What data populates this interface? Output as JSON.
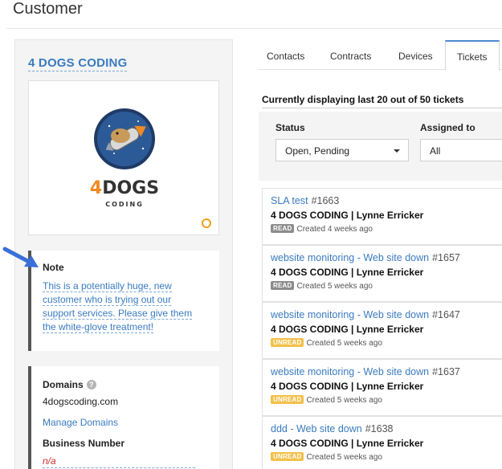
{
  "page": {
    "title": "Customer"
  },
  "customer": {
    "name": "4 DOGS CODING",
    "logo_text": "4DOGS",
    "logo_subtext": "CODING",
    "note": {
      "title": "Note",
      "text": "This is a potentially huge, new customer who is trying out our support services. Please give them the white-glove treatment!"
    },
    "domains_label": "Domains",
    "domain_value": "4dogscoding.com",
    "manage_domains_label": "Manage Domains",
    "business_number_label": "Business Number",
    "business_number_value": "n/a",
    "help_icon": "?"
  },
  "tabs": [
    {
      "label": "Contacts"
    },
    {
      "label": "Contracts"
    },
    {
      "label": "Devices"
    },
    {
      "label": "Tickets",
      "active": true
    }
  ],
  "tickets_header": "Currently displaying last 20 out of 50 tickets",
  "filters": {
    "status_label": "Status",
    "status_value": "Open, Pending",
    "assigned_label": "Assigned to",
    "assigned_value": "All"
  },
  "tickets": [
    {
      "title": "SLA test",
      "number": "#1663",
      "customer": "4 DOGS CODING | Lynne Erricker",
      "status": "READ",
      "created": "Created 4 weeks ago"
    },
    {
      "title": "website monitoring - Web site down",
      "number": "#1657",
      "customer": "4 DOGS CODING | Lynne Erricker",
      "status": "READ",
      "created": "Created 5 weeks ago"
    },
    {
      "title": "website monitoring - Web site down",
      "number": "#1647",
      "customer": "4 DOGS CODING | Lynne Erricker",
      "status": "UNREAD",
      "created": "Created 5 weeks ago"
    },
    {
      "title": "website monitoring - Web site down",
      "number": "#1637",
      "customer": "4 DOGS CODING | Lynne Erricker",
      "status": "UNREAD",
      "created": "Created 5 weeks ago"
    },
    {
      "title": "ddd - Web site down",
      "number": "#1638",
      "customer": "4 DOGS CODING | Lynne Erricker",
      "status": "UNREAD",
      "created": "Created 5 weeks ago"
    }
  ],
  "colors": {
    "link": "#3a7bbf",
    "read_badge": "#8c8c8c",
    "unread_badge": "#f2c04a",
    "arrow": "#3a6fd8"
  }
}
